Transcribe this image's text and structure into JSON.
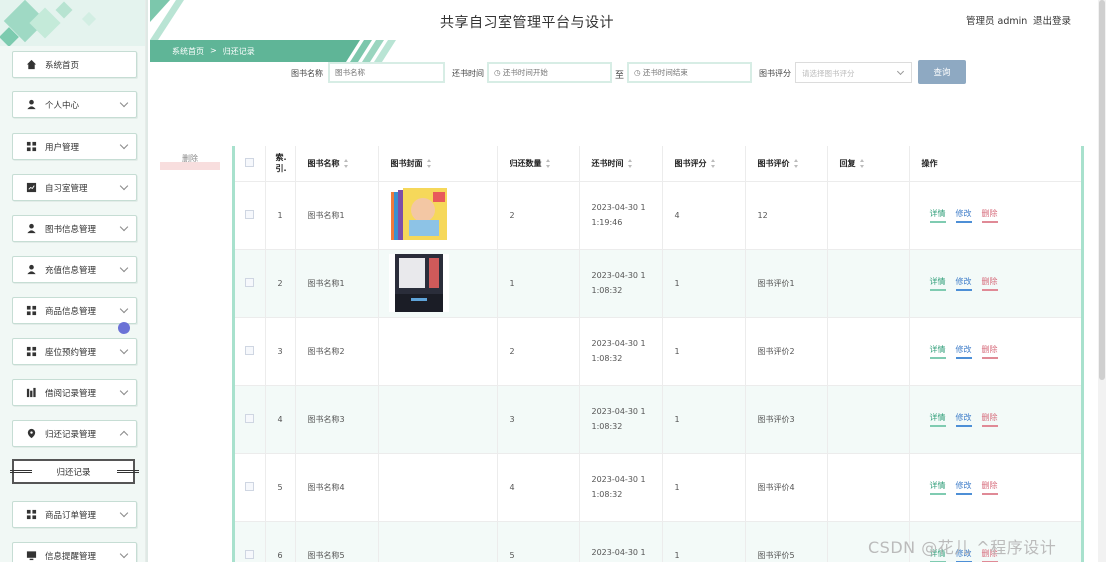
{
  "header": {
    "title": "共享自习室管理平台与设计",
    "user": "管理员 admin",
    "logout": "退出登录"
  },
  "breadcrumb": {
    "home": "系统首页",
    "sep": ">",
    "current": "归还记录"
  },
  "search": {
    "book_name_label": "图书名称",
    "book_name_placeholder": "图书名称",
    "return_time_label": "还书时间",
    "start_placeholder": "◷ 还书时间开始",
    "to": "至",
    "end_placeholder": "◷ 还书时间结束",
    "rating_label": "图书评分",
    "rating_placeholder": "请选择图书评分",
    "button": "查询"
  },
  "actions": {
    "delete": "删除"
  },
  "sidebar": {
    "items": [
      {
        "label": "系统首页",
        "icon": "home-icon"
      },
      {
        "label": "个人中心",
        "icon": "person-icon"
      },
      {
        "label": "用户管理",
        "icon": "grid-icon"
      },
      {
        "label": "自习室管理",
        "icon": "chart-icon"
      },
      {
        "label": "图书信息管理",
        "icon": "person-icon"
      },
      {
        "label": "充值信息管理",
        "icon": "person-icon"
      },
      {
        "label": "商品信息管理",
        "icon": "grid-icon"
      },
      {
        "label": "座位预约管理",
        "icon": "grid-icon"
      },
      {
        "label": "借阅记录管理",
        "icon": "bar-chart-icon"
      },
      {
        "label": "归还记录管理",
        "icon": "location-icon"
      },
      {
        "label": "商品订单管理",
        "icon": "grid-icon"
      },
      {
        "label": "信息提醒管理",
        "icon": "monitor-icon"
      }
    ],
    "sub_item": "归还记录"
  },
  "table": {
    "columns": [
      "索引",
      "图书名称",
      "图书封面",
      "归还数量",
      "还书时间",
      "图书评分",
      "图书评价",
      "回复",
      "操作"
    ],
    "index_header_lines": [
      "索.",
      "引."
    ],
    "ops": {
      "detail": "详情",
      "edit": "修改",
      "delete": "删除"
    },
    "rows": [
      {
        "index": "1",
        "name": "图书名称1",
        "cover": "book1",
        "qty": "2",
        "time1": "2023-04-30 1",
        "time2": "1:19:46",
        "rating": "4",
        "review": "12",
        "reply": ""
      },
      {
        "index": "2",
        "name": "图书名称1",
        "cover": "book2",
        "qty": "1",
        "time1": "2023-04-30 1",
        "time2": "1:08:32",
        "rating": "1",
        "review": "图书评价1",
        "reply": ""
      },
      {
        "index": "3",
        "name": "图书名称2",
        "cover": "",
        "qty": "2",
        "time1": "2023-04-30 1",
        "time2": "1:08:32",
        "rating": "1",
        "review": "图书评价2",
        "reply": ""
      },
      {
        "index": "4",
        "name": "图书名称3",
        "cover": "",
        "qty": "3",
        "time1": "2023-04-30 1",
        "time2": "1:08:32",
        "rating": "1",
        "review": "图书评价3",
        "reply": ""
      },
      {
        "index": "5",
        "name": "图书名称4",
        "cover": "",
        "qty": "4",
        "time1": "2023-04-30 1",
        "time2": "1:08:32",
        "rating": "1",
        "review": "图书评价4",
        "reply": ""
      },
      {
        "index": "6",
        "name": "图书名称5",
        "cover": "",
        "qty": "5",
        "time1": "2023-04-30 1",
        "time2": "",
        "rating": "1",
        "review": "图书评价5",
        "reply": ""
      }
    ]
  },
  "watermark": "CSDN @花儿 ^程序设计"
}
